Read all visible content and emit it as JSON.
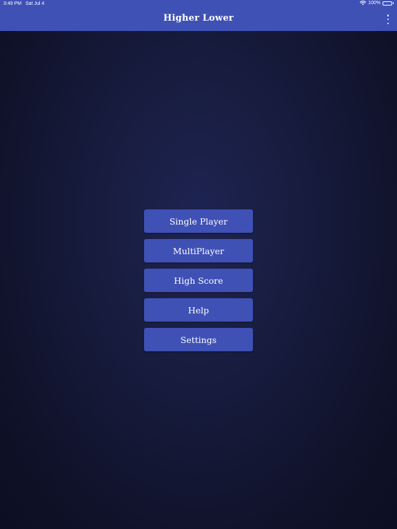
{
  "status_bar": {
    "time": "3:49 PM",
    "date": "Sat Jul 4",
    "battery": "100%",
    "icons": [
      "wifi-icon",
      "battery-icon"
    ]
  },
  "app_bar": {
    "title": "Higher Lower",
    "menu_icon": "more-vert-icon"
  },
  "menu": {
    "buttons": [
      {
        "label": "Single Player"
      },
      {
        "label": "MultiPlayer"
      },
      {
        "label": "High Score"
      },
      {
        "label": "Help"
      },
      {
        "label": "Settings"
      }
    ]
  },
  "colors": {
    "primary": "#3f51b5",
    "background_center": "#1e2452",
    "background_edge": "#0c0e22",
    "text": "#ffffff"
  }
}
